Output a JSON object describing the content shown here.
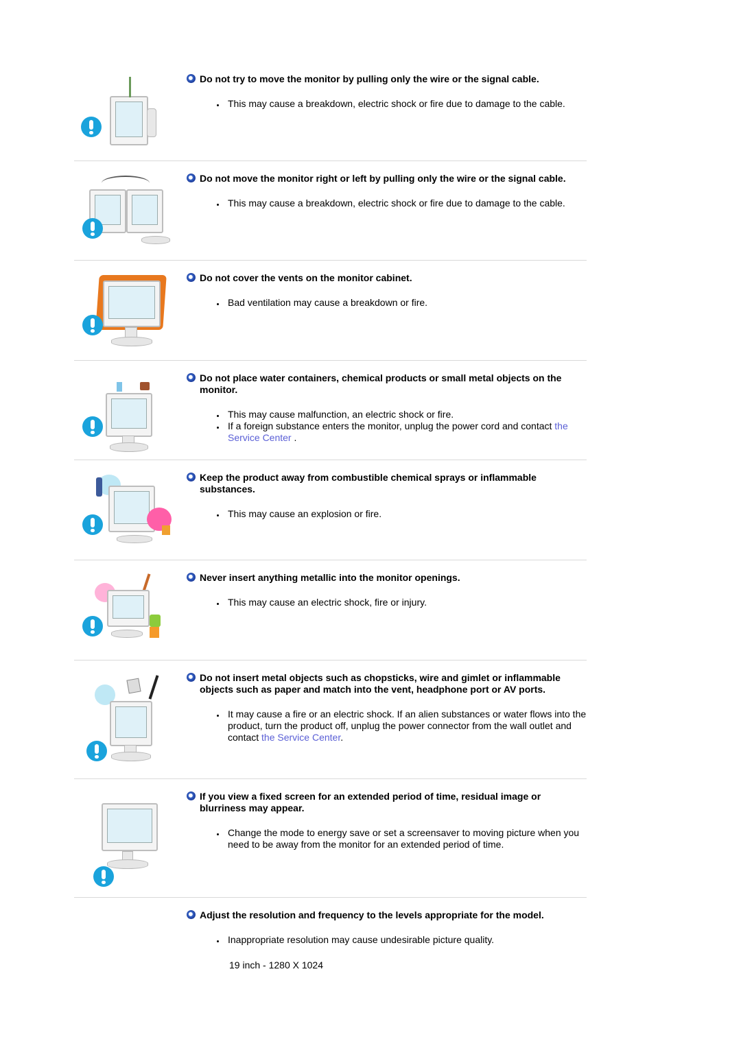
{
  "accent_colors": {
    "warning_icon": "#1aa3dc",
    "bullet_icon": "#2a50b8",
    "link": "#5a5fd6",
    "separator": "#d9d9d9"
  },
  "sections": [
    {
      "title": "Do not try to move the monitor by pulling only the wire or the signal cable.",
      "illustration": "monitor-held-by-cable-illustration",
      "bullets": [
        {
          "text": "This may cause a breakdown, electric shock or fire due to damage to the cable."
        }
      ]
    },
    {
      "title": "Do not move the monitor right or left by pulling only the wire or the signal cable.",
      "illustration": "monitor-swung-by-cable-illustration",
      "bullets": [
        {
          "text": "This may cause a breakdown, electric shock or fire due to damage to the cable."
        }
      ]
    },
    {
      "title": "Do not cover the vents on the monitor cabinet.",
      "illustration": "monitor-covered-by-cloth-illustration",
      "bullets": [
        {
          "text": "Bad ventilation may cause a breakdown or fire."
        }
      ]
    },
    {
      "title": "Do not place water containers, chemical products or small metal objects on the monitor.",
      "illustration": "objects-on-monitor-illustration",
      "bullets": [
        {
          "text": "This may cause malfunction, an electric shock or fire."
        },
        {
          "text": "If a foreign substance enters the monitor, unplug the power cord and contact ",
          "link": "the Service Center",
          "after": " ."
        }
      ]
    },
    {
      "title": "Keep the product away from combustible chemical sprays or inflammable substances.",
      "illustration": "spray-near-monitor-illustration",
      "bullets": [
        {
          "text": "This may cause an explosion or fire."
        }
      ]
    },
    {
      "title": "Never insert anything metallic into the monitor openings.",
      "illustration": "metal-into-monitor-illustration",
      "bullets": [
        {
          "text": "This may cause an electric shock, fire or injury."
        }
      ]
    },
    {
      "title": "Do not insert metal objects such as chopsticks, wire and gimlet or inflammable objects such as paper and match into the vent, headphone port or AV ports.",
      "illustration": "objects-into-ports-illustration",
      "bullets": [
        {
          "text": "It may cause a fire or an electric shock. If an alien substances or water flows into the product, turn the product off, unplug the power connector from the wall outlet and contact ",
          "link": "the Service Center",
          "after": "."
        }
      ]
    },
    {
      "title": "If you view a fixed screen for an extended period of time, residual image or blurriness may appear.",
      "illustration": "fixed-screen-monitor-illustration",
      "bullets": [
        {
          "text": "Change the mode to energy save or set a screensaver to moving picture when you need to be away from the monitor for an extended period of time."
        }
      ]
    },
    {
      "title": "Adjust the resolution and frequency to the levels appropriate for the model.",
      "bullets": [
        {
          "text": "Inappropriate resolution may cause undesirable picture quality."
        }
      ],
      "spec": "19 inch - 1280 X 1024"
    }
  ]
}
